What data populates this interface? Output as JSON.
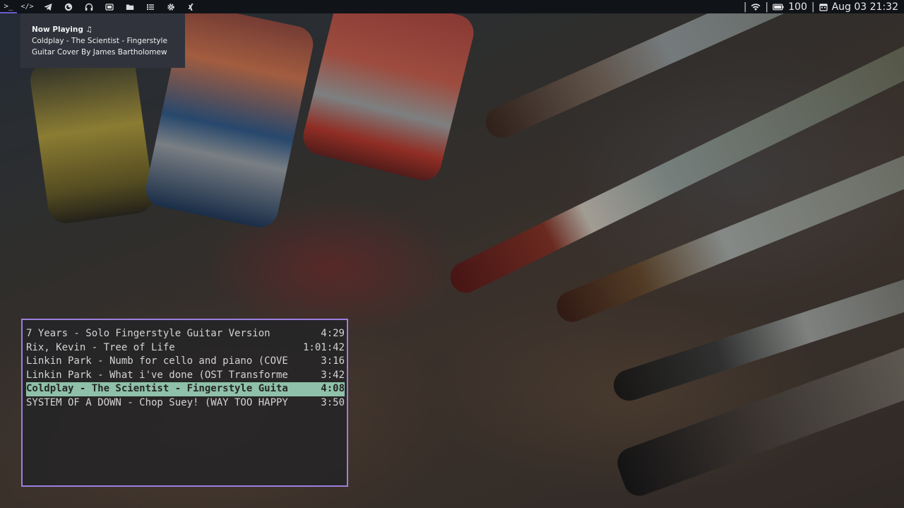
{
  "topbar": {
    "workspaces": [
      {
        "icon": "terminal-icon",
        "glyph": ">_"
      },
      {
        "icon": "code-icon",
        "glyph": "</>"
      },
      {
        "icon": "telegram-icon",
        "glyph": ""
      },
      {
        "icon": "firefox-icon",
        "glyph": ""
      },
      {
        "icon": "headphones-icon",
        "glyph": ""
      },
      {
        "icon": "chat-icon",
        "glyph": ""
      },
      {
        "icon": "folder-icon",
        "glyph": ""
      },
      {
        "icon": "list-icon",
        "glyph": ""
      },
      {
        "icon": "gear-icon",
        "glyph": ""
      },
      {
        "icon": "xing-icon",
        "glyph": ""
      }
    ],
    "status": {
      "separator": "|",
      "battery": "100",
      "datetime": "Aug 03 21:32"
    }
  },
  "notification": {
    "title": "Now Playing ♫",
    "line1": "Coldplay - The Scientist - Fingerstyle",
    "line2": "Guitar Cover By James Bartholomew"
  },
  "playlist": {
    "tracks": [
      {
        "title": "7 Years - Solo Fingerstyle Guitar Version",
        "duration": "   4:29",
        "selected": false
      },
      {
        "title": "Rix, Kevin - Tree of Life",
        "duration": "1:01:42",
        "selected": false
      },
      {
        "title": "Linkin Park - Numb for cello and piano (COVE",
        "duration": "3:16",
        "selected": false
      },
      {
        "title": "Linkin Park - What i've done (OST Transforme",
        "duration": "3:42",
        "selected": false
      },
      {
        "title": "Coldplay - The Scientist - Fingerstyle Guita",
        "duration": "4:08",
        "selected": true
      },
      {
        "title": "SYSTEM OF A DOWN - Chop Suey! (WAY TOO HAPPY",
        "duration": "3:50",
        "selected": false
      }
    ]
  },
  "colors": {
    "bar_bg": "#101318",
    "workspace_accent": "#6a5acd",
    "terminal_border": "#9c7fe0",
    "selected_row": "#8fc0a9"
  }
}
